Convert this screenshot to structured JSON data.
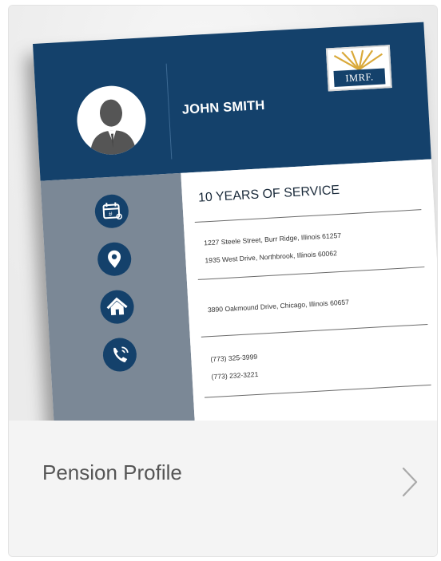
{
  "card": {
    "title": "Pension Profile",
    "chevron_icon": "chevron-right-icon"
  },
  "profile_doc": {
    "name": "JOHN SMITH",
    "logo_text": "IMRF.",
    "service_heading": "10 YEARS OF SERVICE",
    "addresses": [
      "1227 Steele Street, Burr Ridge, Illinois 61257",
      "1935 West Drive, Northbrook, Illinois 60062"
    ],
    "home_address": "3890 Oakmound Drive, Chicago, Illinois 60657",
    "phones": [
      "(773) 325-3999",
      "(773) 232-3221"
    ],
    "icons": [
      "calendar-badge-icon",
      "location-pin-icon",
      "home-icon",
      "phone-icon"
    ]
  },
  "colors": {
    "navy": "#14416b",
    "sidebar_gray": "#7b8896",
    "logo_gold": "#d9a93a"
  }
}
